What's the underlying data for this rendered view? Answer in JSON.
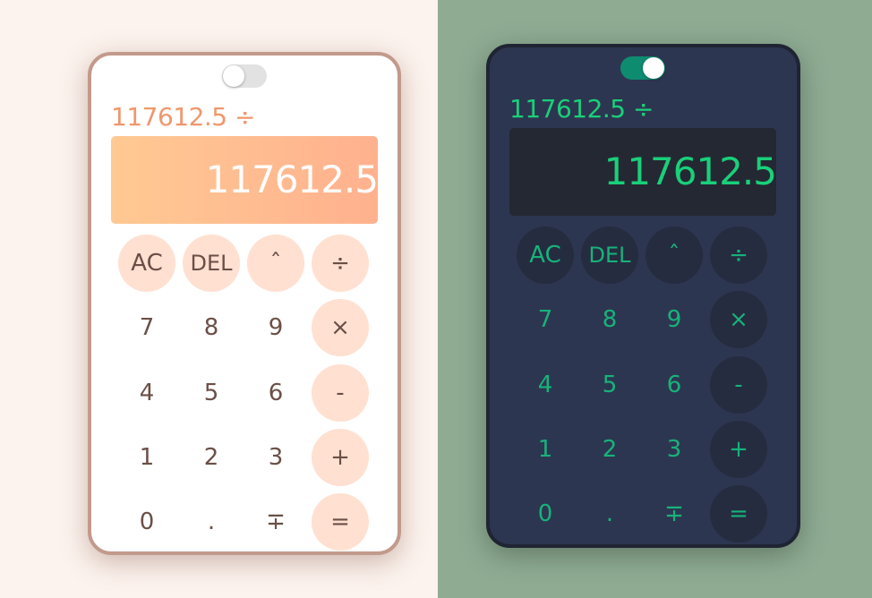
{
  "themes": {
    "light": {
      "accent": "#f0976d",
      "key_fill": "#ffe0d1",
      "text": "#6b4f47",
      "toggle_on": false
    },
    "dark": {
      "accent": "#19d07a",
      "key_fill": "#252c40",
      "text": "#18b27a",
      "toggle_on": true
    }
  },
  "light": {
    "expression": "117612.5 ÷",
    "display": "117612.5"
  },
  "dark": {
    "expression": "117612.5 ÷",
    "display": "117612.5"
  },
  "keys": {
    "ac": "AC",
    "del": "DEL",
    "power": "ˆ",
    "divide": "÷",
    "seven": "7",
    "eight": "8",
    "nine": "9",
    "multiply": "×",
    "four": "4",
    "five": "5",
    "six": "6",
    "minus": "-",
    "one": "1",
    "two": "2",
    "three": "3",
    "plus": "+",
    "zero": "0",
    "dot": ".",
    "negate": "∓",
    "equals": "="
  }
}
